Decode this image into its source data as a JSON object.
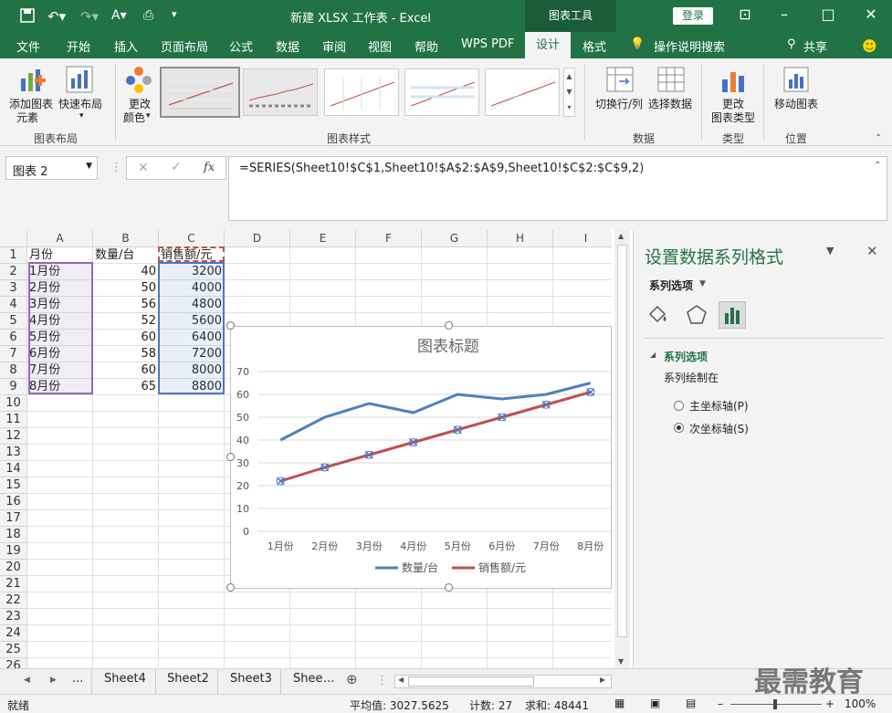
{
  "app": {
    "title": "新建 XLSX 工作表  -  Excel",
    "context_tab": "图表工具",
    "login": "登录"
  },
  "menu": [
    "文件",
    "开始",
    "插入",
    "页面布局",
    "公式",
    "数据",
    "审阅",
    "视图",
    "帮助",
    "WPS PDF",
    "设计",
    "格式"
  ],
  "tell_me": "操作说明搜索",
  "share": "共享",
  "ribbon": {
    "add_element": "添加图表",
    "add_element2": "元素",
    "quick_layout": "快速布局",
    "change_color": "更改",
    "change_color2": "颜色",
    "switch_rowcol": "切换行/列",
    "select_data": "选择数据",
    "change_type": "更改",
    "change_type2": "图表类型",
    "move_chart": "移动图表",
    "groups": {
      "layout": "图表布局",
      "styles": "图表样式",
      "data": "数据",
      "type": "类型",
      "location": "位置"
    }
  },
  "formula_bar": {
    "name_box": "图表 2",
    "fx": "fx",
    "formula": "=SERIES(Sheet10!$C$1,Sheet10!$A$2:$A$9,Sheet10!$C$2:$C$9,2)"
  },
  "sheet": {
    "columns": [
      "A",
      "B",
      "C",
      "D",
      "E",
      "F",
      "G",
      "H",
      "I"
    ],
    "rows": [
      "1",
      "2",
      "3",
      "4",
      "5",
      "6",
      "7",
      "8",
      "9",
      "10",
      "11",
      "12",
      "13",
      "14",
      "15",
      "16",
      "17",
      "18",
      "19",
      "20",
      "21",
      "22",
      "23",
      "24",
      "25",
      "26"
    ],
    "header": [
      "月份",
      "数量/台",
      "销售额/元"
    ],
    "data": [
      [
        "1月份",
        "40",
        "3200"
      ],
      [
        "2月份",
        "50",
        "4000"
      ],
      [
        "3月份",
        "56",
        "4800"
      ],
      [
        "4月份",
        "52",
        "5600"
      ],
      [
        "5月份",
        "60",
        "6400"
      ],
      [
        "6月份",
        "58",
        "7200"
      ],
      [
        "7月份",
        "60",
        "8000"
      ],
      [
        "8月份",
        "65",
        "8800"
      ]
    ]
  },
  "chart_data": {
    "type": "line",
    "title": "图表标题",
    "categories": [
      "1月份",
      "2月份",
      "3月份",
      "4月份",
      "5月份",
      "6月份",
      "7月份",
      "8月份"
    ],
    "yticks": [
      "70",
      "60",
      "50",
      "40",
      "30",
      "20",
      "10",
      "0"
    ],
    "ylim": [
      0,
      70
    ],
    "grid": true,
    "legend": "bottom",
    "series": [
      {
        "name": "数量/台",
        "values": [
          40,
          50,
          56,
          52,
          60,
          58,
          60,
          65
        ],
        "color": "#4f81bd"
      },
      {
        "name": "销售额/元",
        "values": [
          22,
          28,
          33.5,
          39,
          44.5,
          50,
          55.5,
          61
        ],
        "color": "#c0504d"
      }
    ]
  },
  "pane": {
    "title": "设置数据系列格式",
    "series_options": "系列选项",
    "section": "系列选项",
    "plot_on": "系列绘制在",
    "primary": "主坐标轴(P)",
    "secondary": "次坐标轴(S)"
  },
  "tabs": {
    "more": "...",
    "sheets": [
      "Sheet4",
      "Sheet2",
      "Sheet3",
      "Shee"
    ],
    "more2": "..."
  },
  "status": {
    "ready": "就绪",
    "average": "平均值: 3027.5625",
    "count": "计数: 27",
    "sum": "求和: 48441",
    "zoom": "100%"
  },
  "watermark": "最需教育"
}
